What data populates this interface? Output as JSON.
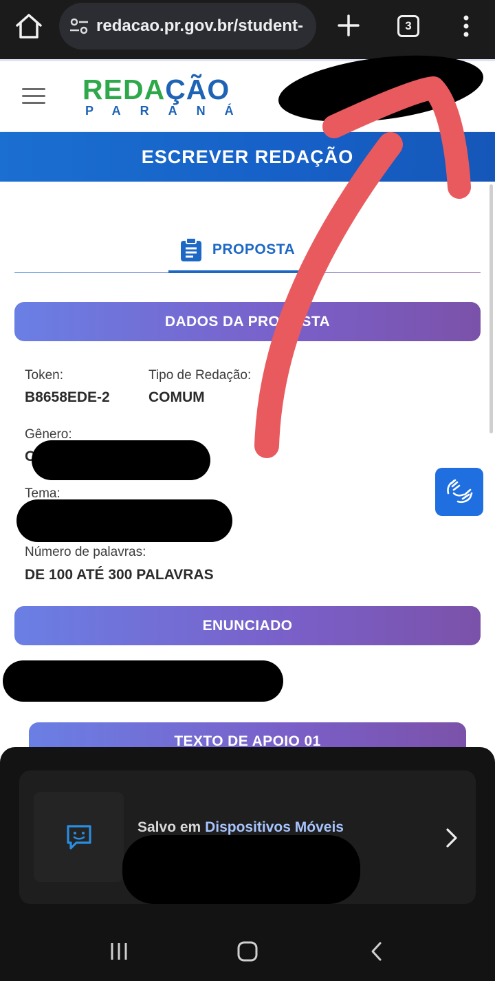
{
  "browser": {
    "url": "redacao.pr.gov.br/student-",
    "tab_count": "3"
  },
  "site": {
    "logo_top": "REDAÇÃO",
    "logo_top_part1": "REDA",
    "logo_top_part2": "ÇÃO",
    "logo_bottom": "PARANÁ"
  },
  "page": {
    "title": "ESCREVER REDAÇÃO",
    "tab_label": "PROPOSTA"
  },
  "sections": {
    "dados": "DADOS DA PROPOSTA",
    "enunciado": "ENUNCIADO",
    "texto_apoio": "TEXTO DE APOIO 01"
  },
  "fields": {
    "token_label": "Token:",
    "token_value": "B8658EDE-2",
    "tipo_label": "Tipo de Redação:",
    "tipo_value": "COMUM",
    "genero_label": "Gênero:",
    "genero_value_start": "O",
    "tema_label": "Tema:",
    "palavras_label": "Número de palavras:",
    "palavras_value": "DE 100 ATÉ 300 PALAVRAS"
  },
  "notification": {
    "prefix": "Salvo em ",
    "link": "Dispositivos Móveis"
  },
  "colors": {
    "brand_blue": "#1d68c4",
    "brand_green": "#2ea84b",
    "pill_start": "#6a7fe4",
    "pill_end": "#7b52a9",
    "annotation_red": "#e95a5e"
  },
  "icons": [
    "home-icon",
    "site-settings-icon",
    "new-tab-icon",
    "tab-switcher-icon",
    "more-options-icon",
    "hamburger-menu-icon",
    "clipboard-icon",
    "sign-language-icon",
    "chat-bot-icon",
    "chevron-right-icon",
    "recents-icon",
    "home-nav-icon",
    "back-icon"
  ]
}
